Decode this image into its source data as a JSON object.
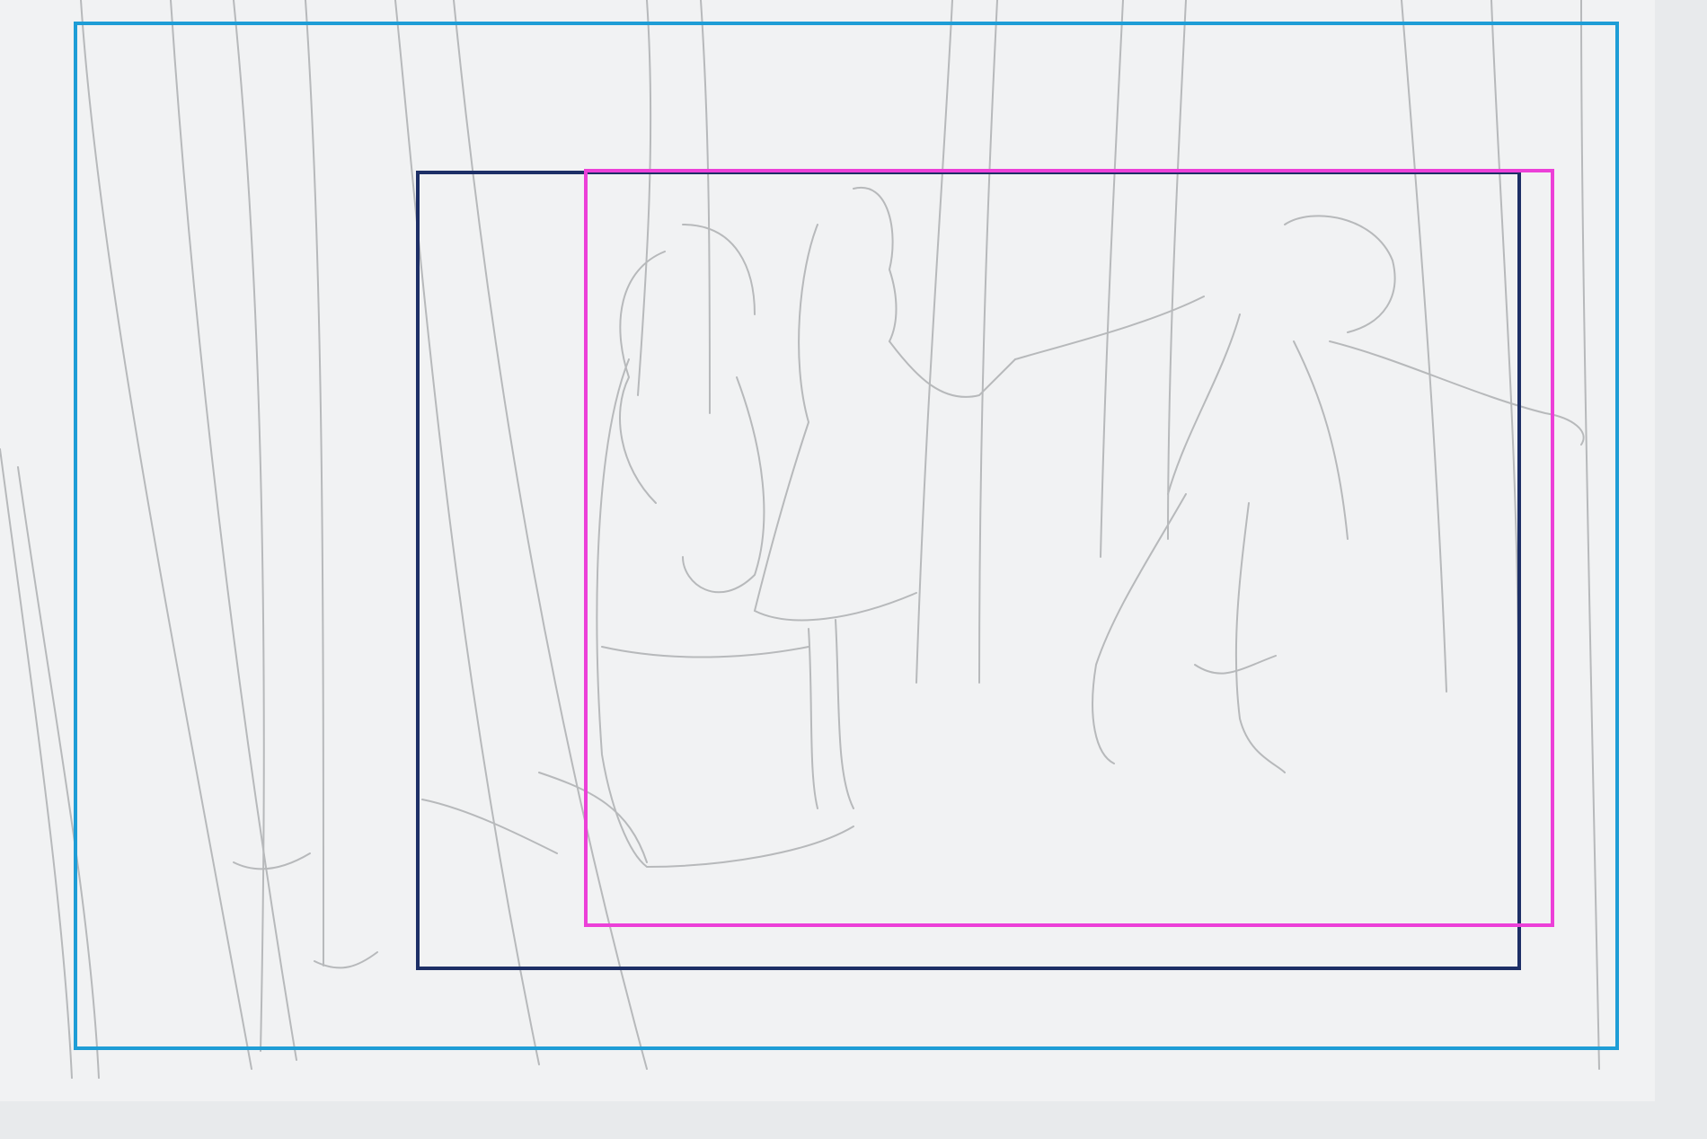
{
  "image": {
    "description_color_paper": "#f1f2f3",
    "description_color_background": "#e8eaec"
  },
  "frames": [
    {
      "name": "outer-crop-frame",
      "color": "#1e9dd6"
    },
    {
      "name": "magenta-crop-frame",
      "color": "#ec40d8"
    },
    {
      "name": "navy-crop-frame",
      "color": "#1d2f66"
    }
  ],
  "icons": [
    "pencil-sketch-illustration"
  ]
}
